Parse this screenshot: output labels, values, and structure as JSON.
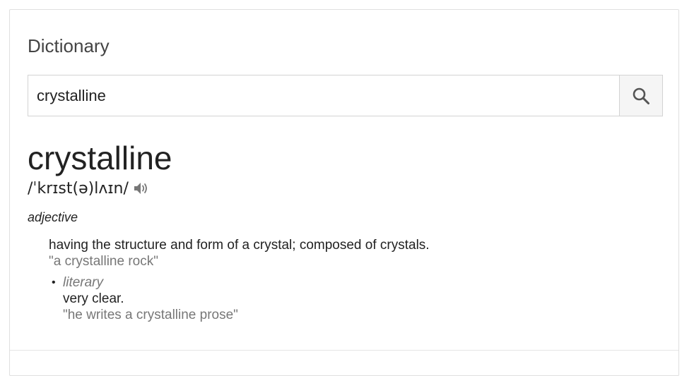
{
  "card": {
    "title": "Dictionary"
  },
  "search": {
    "value": "crystalline",
    "button_icon": "search-icon"
  },
  "entry": {
    "headword": "crystalline",
    "pronunciation": "/ˈkrɪst(ə)lʌɪn/",
    "audio_icon": "speaker-icon",
    "part_of_speech": "adjective",
    "senses": [
      {
        "definition": "having the structure and form of a crystal; composed of crystals.",
        "example": "\"a crystalline rock\""
      }
    ],
    "sub_senses": [
      {
        "register": "literary",
        "definition": "very clear.",
        "example": "\"he writes a crystalline prose\""
      }
    ]
  },
  "colors": {
    "text": "#222222",
    "muted": "#777777",
    "border": "#d3d3d3",
    "button_bg": "#f5f5f5"
  }
}
